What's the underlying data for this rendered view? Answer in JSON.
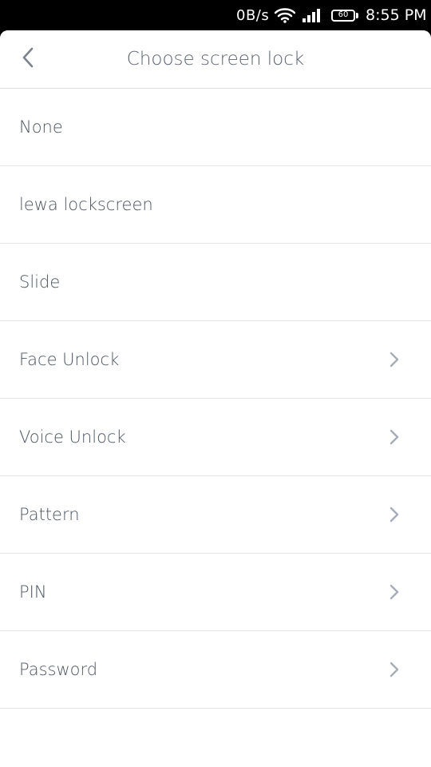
{
  "status_bar": {
    "network_speed": "0B/s",
    "battery_level": "60",
    "time": "8:55 PM",
    "icons": [
      "wifi-icon",
      "cell-signal-icon",
      "battery-icon"
    ]
  },
  "header": {
    "title": "Choose screen lock",
    "back_icon": "chevron-left-icon"
  },
  "options": [
    {
      "label": "None",
      "has_chevron": false
    },
    {
      "label": "lewa lockscreen",
      "has_chevron": false
    },
    {
      "label": "Slide",
      "has_chevron": false
    },
    {
      "label": "Face Unlock",
      "has_chevron": true
    },
    {
      "label": "Voice Unlock",
      "has_chevron": true
    },
    {
      "label": "Pattern",
      "has_chevron": true
    },
    {
      "label": "PIN",
      "has_chevron": true
    },
    {
      "label": "Password",
      "has_chevron": true
    }
  ],
  "colors": {
    "title_text": "#5b6270",
    "item_text": "#4c5562",
    "divider": "#e5e5e5",
    "chevron": "#a7adb6"
  }
}
